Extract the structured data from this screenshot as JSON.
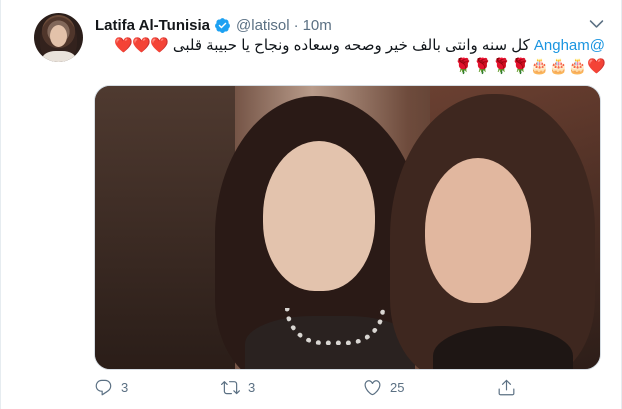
{
  "tweet": {
    "display_name": "Latifa Al-Tunisia",
    "handle": "@latisol",
    "separator": "·",
    "time": "10m",
    "text_mention": "@Angham",
    "text_body": "كل سنه وانتى بالف خير وصحه وسعاده ونجاح يا حبيبة قلبى",
    "emojis_line1": [
      "❤️",
      "❤️",
      "❤️"
    ],
    "emojis_line2": [
      "🌹",
      "🌹",
      "🌹",
      "🌹",
      "🎂",
      "🎂",
      "🎂",
      "❤️"
    ],
    "replies": "3",
    "retweets": "3",
    "likes": "25"
  },
  "icons": {
    "verified": "verified-badge-icon",
    "more": "chevron-down-icon",
    "reply": "reply-icon",
    "retweet": "retweet-icon",
    "like": "heart-icon",
    "share": "share-icon"
  },
  "colors": {
    "verified": "#1da1f2",
    "link": "#1b95e0",
    "secondary_text": "#5b7083",
    "primary_text": "#0f1419"
  }
}
